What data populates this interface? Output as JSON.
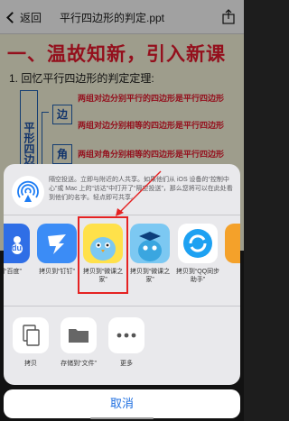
{
  "nav": {
    "back_label": "返回",
    "title": "平行四边形的判定.ppt"
  },
  "slide": {
    "heading": "一、温故知新，引入新课",
    "subheading": "1. 回忆平行四边形的判定定理:",
    "vertical_label": "平形四边形",
    "boxes": [
      "边",
      "角"
    ],
    "rules": [
      "两组对边分别平行的四边形是平行四边形",
      "两组对边分别相等的四边形是平行四边形",
      "两组对角分别相等的四边形是平行四边形"
    ]
  },
  "share": {
    "airdrop_text": "隔空投送。立即与附近的人共享。如果他们从 iOS 设备的“控制中心”或 Mac 上的“访达”中打开了“隔空投送”，那么您将可以在此处看到他们的名字。轻点即可共享。",
    "apps": [
      {
        "label": "到“百度”",
        "icon": "baidu-icon",
        "color": "#2f6ee6"
      },
      {
        "label": "拷贝到“钉钉”",
        "icon": "dingtalk-icon",
        "color": "#3b8cf6"
      },
      {
        "label": "拷贝到“微课之家”",
        "icon": "weike-bird-icon",
        "color": "#7cc8f2"
      },
      {
        "label": "拷贝到“微课之家”",
        "icon": "weike-grad-icon",
        "color": "#7cc8f2"
      },
      {
        "label": "拷贝到“QQ同步助手”",
        "icon": "qq-sync-icon",
        "color": "#1da1f2"
      },
      {
        "label": "拷",
        "icon": "partial-icon",
        "color": "#f4a12a"
      }
    ],
    "actions": [
      {
        "label": "拷贝",
        "icon": "copy-icon"
      },
      {
        "label": "存储到“文件”",
        "icon": "folder-icon"
      },
      {
        "label": "更多",
        "icon": "more-icon"
      }
    ],
    "cancel_label": "取消",
    "accent": "#e52222"
  }
}
